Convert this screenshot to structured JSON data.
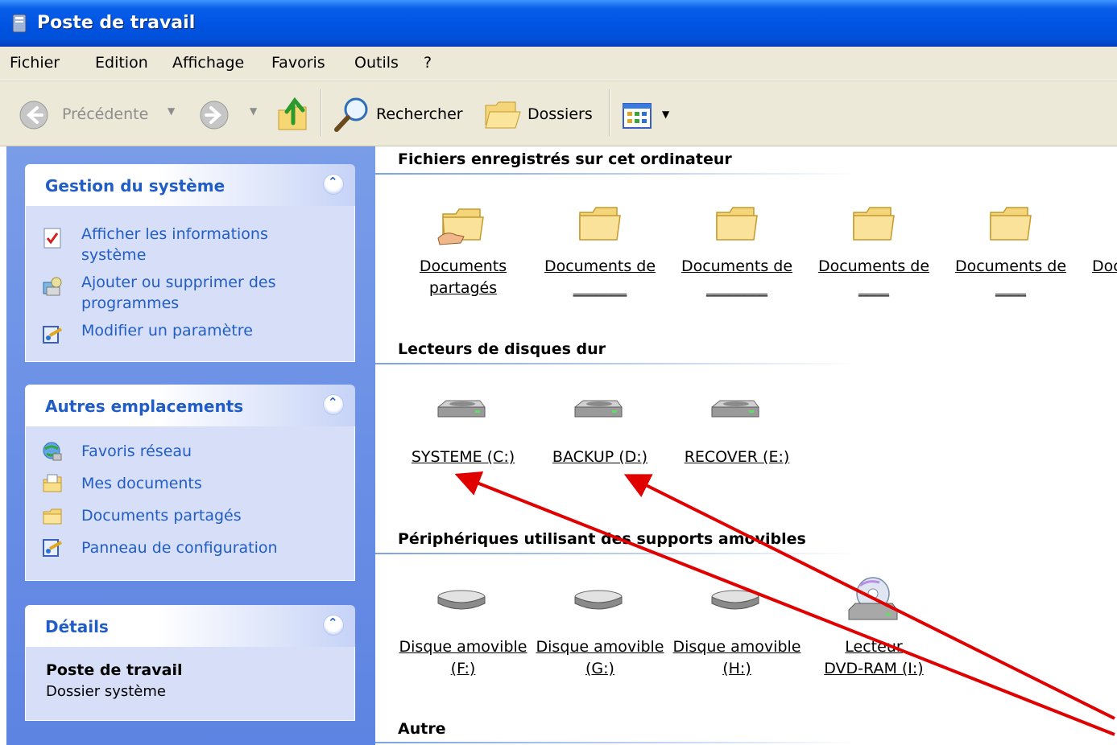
{
  "window": {
    "title": "Poste de travail"
  },
  "menu": [
    "Fichier",
    "Edition",
    "Affichage",
    "Favoris",
    "Outils",
    "?"
  ],
  "toolbar": {
    "back_label": "Précédente",
    "search_label": "Rechercher",
    "folders_label": "Dossiers"
  },
  "panels": {
    "system": {
      "title": "Gestion du système",
      "links": [
        {
          "line1": "Afficher les informations",
          "line2": "système"
        },
        {
          "line1": "Ajouter ou supprimer des",
          "line2": "programmes"
        },
        {
          "line1": "Modifier un paramètre"
        }
      ]
    },
    "places": {
      "title": "Autres emplacements",
      "links": [
        "Favoris réseau",
        "Mes documents",
        "Documents partagés",
        "Panneau de configuration"
      ]
    },
    "details": {
      "title": "Détails",
      "name": "Poste de travail",
      "type": "Dossier système"
    }
  },
  "sections": {
    "files": {
      "title": "Fichiers enregistrés sur cet ordinateur",
      "items": [
        {
          "line1": "Documents",
          "line2": "partagés"
        },
        {
          "line1": "Documents de",
          "line2": "_______"
        },
        {
          "line1": "Documents de",
          "line2": "________"
        },
        {
          "line1": "Documents de",
          "line2": "____"
        },
        {
          "line1": "Documents de",
          "line2": "____"
        },
        {
          "line1": "Doc"
        }
      ]
    },
    "drives": {
      "title": "Lecteurs de disques dur",
      "items": [
        "SYSTEME (C:)",
        "BACKUP (D:)",
        "RECOVER (E:)"
      ]
    },
    "removable": {
      "title": "Périphériques utilisant des supports amovibles",
      "items": [
        {
          "line1": "Disque amovible",
          "line2": "(F:)"
        },
        {
          "line1": "Disque amovible",
          "line2": "(G:)"
        },
        {
          "line1": "Disque amovible",
          "line2": "(H:)"
        },
        {
          "line1": "Lecteur",
          "line2": "DVD-RAM (I:)"
        }
      ]
    },
    "other": {
      "title": "Autre"
    }
  },
  "colors": {
    "titlebar": "#0054e3",
    "link": "#215dc6",
    "annotation_arrow": "#e00000"
  }
}
